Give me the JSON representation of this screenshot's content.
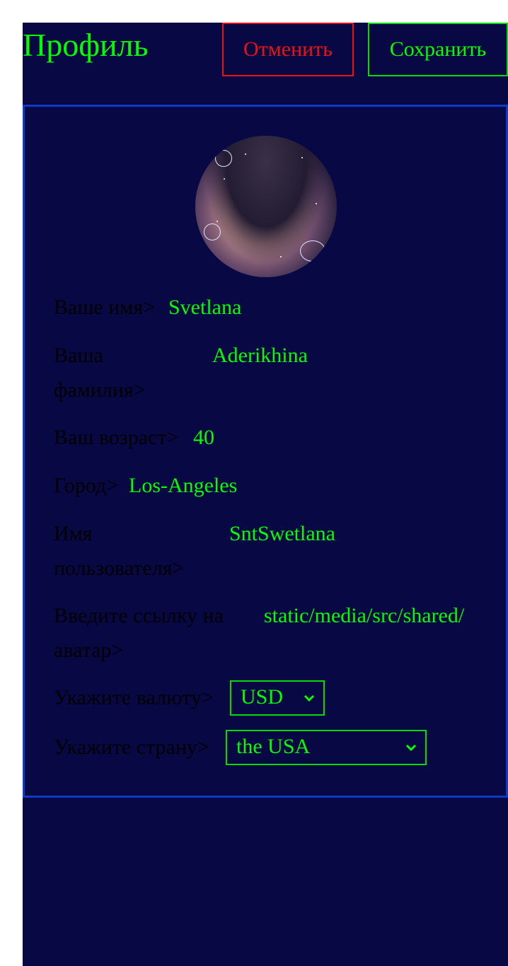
{
  "header": {
    "title": "Профиль",
    "cancel_label": "Отменить",
    "save_label": "Сохранить"
  },
  "profile": {
    "first_name": {
      "label": "Ваше имя>",
      "value": "Svetlana"
    },
    "last_name": {
      "label": "Ваша фамилия>",
      "value": "Aderikhina"
    },
    "age": {
      "label": "Ваш возраст>",
      "value": "40"
    },
    "city": {
      "label": "Город>",
      "value": "Los-Angeles"
    },
    "username": {
      "label": "Имя пользователя>",
      "value": "SntSwetlana"
    },
    "avatar_link": {
      "label": "Введите ссылку на аватар>",
      "value": "static/media/src/shared/"
    },
    "currency": {
      "label": "Укажите валюту>",
      "value": "USD"
    },
    "country": {
      "label": "Укажите страну>",
      "value": "the USA"
    }
  },
  "colors": {
    "background": "#080845",
    "accent": "#00ff00",
    "danger": "#ee1111",
    "card_border": "#0a3cc8"
  }
}
